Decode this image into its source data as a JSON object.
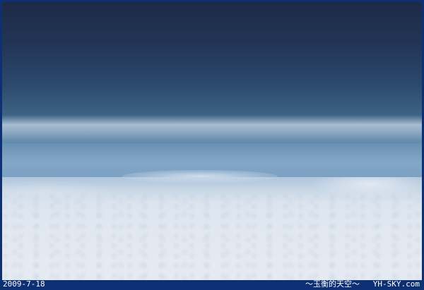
{
  "photo": {
    "subject": "aerial-sky-above-clouds"
  },
  "footer": {
    "date": "2009-7-18",
    "site_name": "～玉衡的天空～",
    "site_url": "YH-SKY.com"
  },
  "colors": {
    "frame": "#0d2f74",
    "sky_top": "#1d2a46",
    "clouds": "#e2e8f0",
    "caption_text": "#ffffff"
  }
}
